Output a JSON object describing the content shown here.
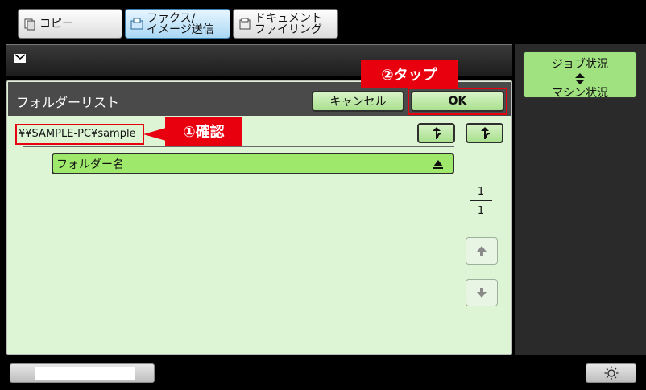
{
  "tabs": [
    {
      "label": "コピー"
    },
    {
      "label": "ファクス/\nイメージ送信"
    },
    {
      "label": "ドキュメント\nファイリング"
    }
  ],
  "panel": {
    "title": "フォルダーリスト",
    "cancel_label": "キャンセル",
    "ok_label": "OK",
    "path": "¥¥SAMPLE-PC¥sample",
    "column_header": "フォルダー名",
    "page_current": "1",
    "page_total": "1"
  },
  "callouts": {
    "confirm": "①確認",
    "tap": "②タップ"
  },
  "side": {
    "job_status": "ジョブ状況",
    "machine_status": "マシン状況"
  },
  "icons": {
    "mail": "mail-icon",
    "up_folder": "up-folder-icon",
    "root_folder": "root-folder-icon",
    "sort": "sort-ascending-icon",
    "page_up": "page-up-icon",
    "page_down": "page-down-icon",
    "brightness": "brightness-icon"
  },
  "colors": {
    "panel_bg": "#ddf5d5",
    "button_green": "#a8e08d",
    "callout_red": "#e8000f",
    "header_dark": "#4a4a4a",
    "active_tab": "#a9d7f4"
  }
}
